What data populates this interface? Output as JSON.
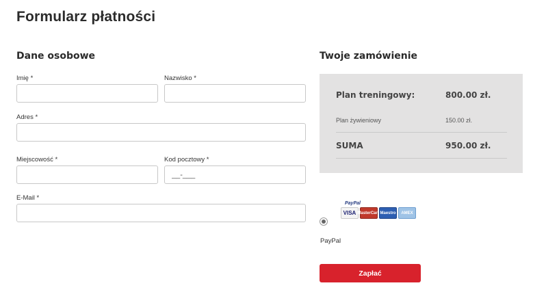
{
  "page": {
    "title": "Formularz płatności"
  },
  "personal": {
    "title": "Dane osobowe",
    "fields": {
      "first_name": {
        "label": "Imię *",
        "value": "",
        "placeholder": ""
      },
      "last_name": {
        "label": "Nazwisko *",
        "value": "",
        "placeholder": ""
      },
      "address": {
        "label": "Adres *",
        "value": "",
        "placeholder": ""
      },
      "city": {
        "label": "Miejscowość *",
        "value": "",
        "placeholder": ""
      },
      "postal_code": {
        "label": "Kod pocztowy *",
        "value": "",
        "placeholder": "__-___"
      },
      "email": {
        "label": "E-Mail *",
        "value": "",
        "placeholder": ""
      }
    }
  },
  "order": {
    "title": "Twoje zamówienie",
    "rows": [
      {
        "label": "Plan treningowy:",
        "value": "800.00 zł."
      },
      {
        "label": "Plan żywieniowy",
        "value": "150.00 zł."
      }
    ],
    "total": {
      "label": "SUMA",
      "value": "950.00 zł."
    }
  },
  "payment": {
    "method_label": "PayPal",
    "logo_text": "PayPal",
    "cards": [
      "VISA",
      "MasterCard",
      "Maestro",
      "AMEX"
    ],
    "selected": true,
    "pay_button": "Zapłać"
  },
  "colors": {
    "accent": "#d8222c",
    "summary_bg": "#e3e2e2",
    "input_border": "#c7c7c7"
  }
}
